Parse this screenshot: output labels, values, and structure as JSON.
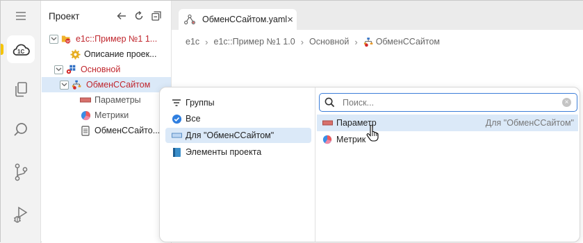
{
  "activity_bar": {
    "items": [
      {
        "icon": "hamburger-menu-icon"
      },
      {
        "icon": "1c-cloud-icon",
        "active": true
      },
      {
        "icon": "copy-files-icon"
      },
      {
        "icon": "search-icon"
      },
      {
        "icon": "source-control-icon"
      },
      {
        "icon": "run-debug-icon"
      }
    ],
    "accent": "#f5c400"
  },
  "project": {
    "title": "Проект",
    "tree": [
      {
        "label": "e1c::Пример №1 1...",
        "icon": "project-folder-icon",
        "expanded": true
      },
      {
        "label": "Описание проек...",
        "icon": "gear-icon"
      },
      {
        "label": "Основной",
        "icon": "subsystem-icon",
        "expanded": true
      },
      {
        "label": "ОбменССайтом",
        "icon": "exchange-icon",
        "expanded": true,
        "selected": true
      },
      {
        "label": "Параметры",
        "icon": "parameters-icon"
      },
      {
        "label": "Метрики",
        "icon": "metrics-icon"
      },
      {
        "label": "ОбменССайто...",
        "icon": "yaml-file-icon"
      }
    ]
  },
  "editor": {
    "tab": {
      "label": "ОбменССайтом.yaml",
      "close": "×"
    },
    "breadcrumb": [
      "e1c",
      "e1c::Пример №1 1.0",
      "Основной",
      "ОбменССайтом"
    ]
  },
  "popup": {
    "groups_header": "Группы",
    "groups": [
      {
        "label": "Все",
        "icon": "check-circle-icon"
      },
      {
        "label": "Для \"ОбменССайтом\"",
        "icon": "rectangle-icon",
        "selected": true
      },
      {
        "label": "Элементы проекта",
        "icon": "book-icon"
      }
    ],
    "search": {
      "placeholder": "Поиск...",
      "value": ""
    },
    "results": [
      {
        "label": "Параметр",
        "hint": "Для \"ОбменССайтом\"",
        "icon": "parameter-icon",
        "selected": true
      },
      {
        "label": "Метрик",
        "hint": "",
        "icon": "metrics-icon"
      }
    ]
  },
  "colors": {
    "selection": "#dbe9f8",
    "error_red": "#c0262d",
    "focus_blue": "#3b7dd8"
  }
}
